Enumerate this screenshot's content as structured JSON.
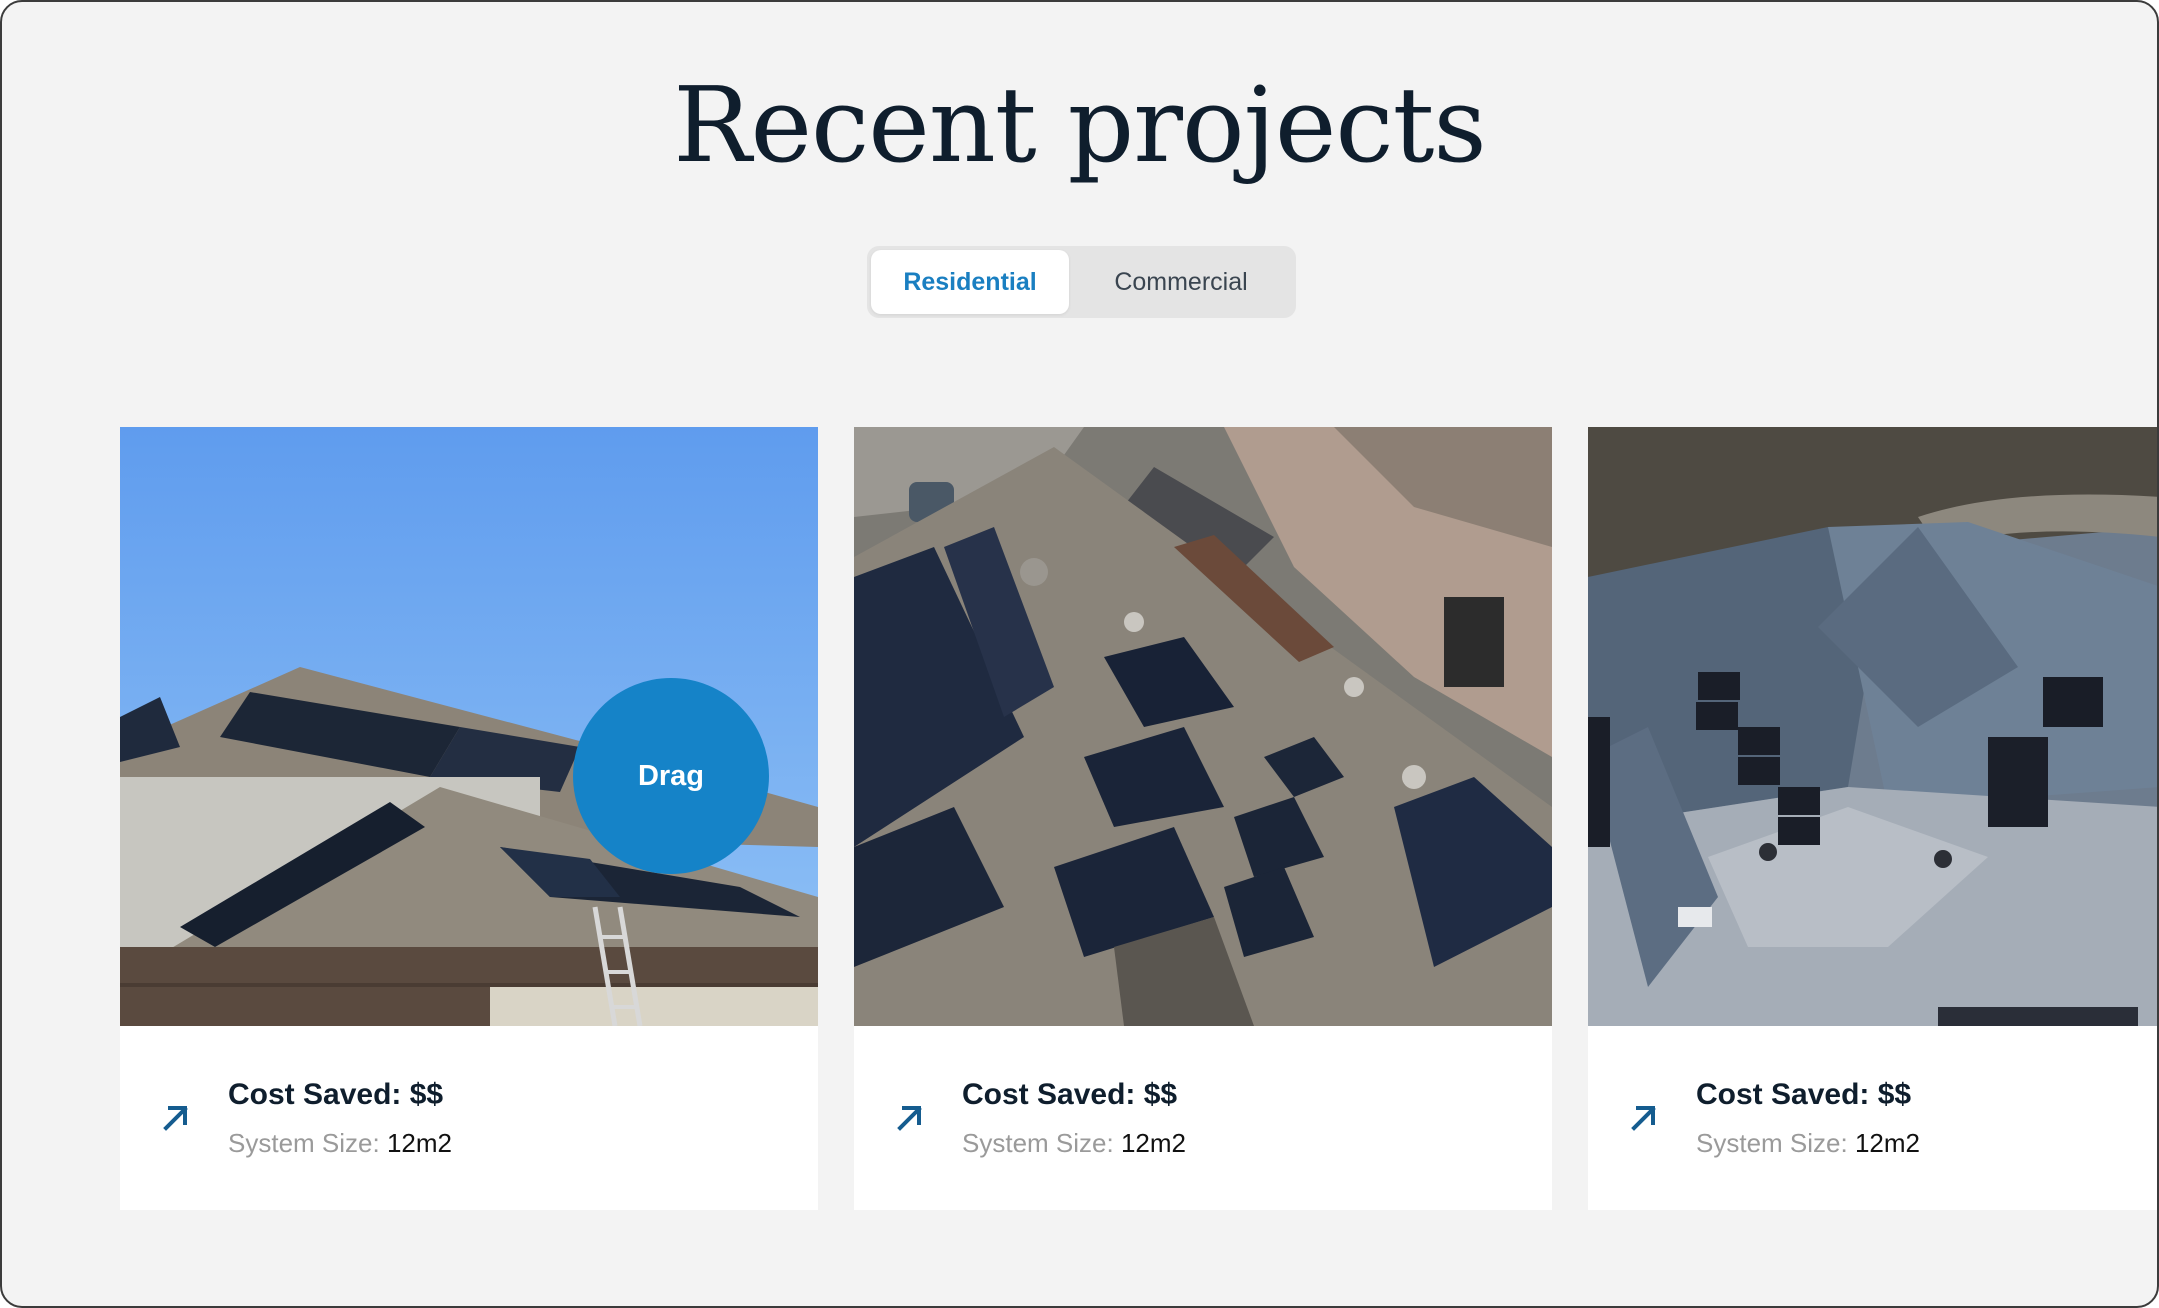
{
  "section": {
    "title": "Recent projects"
  },
  "tabs": [
    {
      "label": "Residential",
      "active": true
    },
    {
      "label": "Commercial",
      "active": false
    }
  ],
  "projects": [
    {
      "cost_label": "Cost Saved: $$",
      "size_label": "System Size:",
      "size_value": "12m2",
      "image": "house-with-rooftop-solar-panels"
    },
    {
      "cost_label": "Cost Saved: $$",
      "size_label": "System Size:",
      "size_value": "12m2",
      "image": "aerial-roof-solar-panels"
    },
    {
      "cost_label": "Cost Saved: $$",
      "size_label": "System Size:",
      "size_value": "12m2",
      "image": "aerial-gray-roof-solar-panels"
    }
  ],
  "drag_cursor": {
    "label": "Drag"
  },
  "icons": {
    "card_link": "arrow-up-right-icon"
  },
  "colors": {
    "accent": "#1583c8",
    "active_tab_text": "#1a7fc1",
    "heading": "#0f1e2d",
    "background": "#f3f3f3"
  }
}
